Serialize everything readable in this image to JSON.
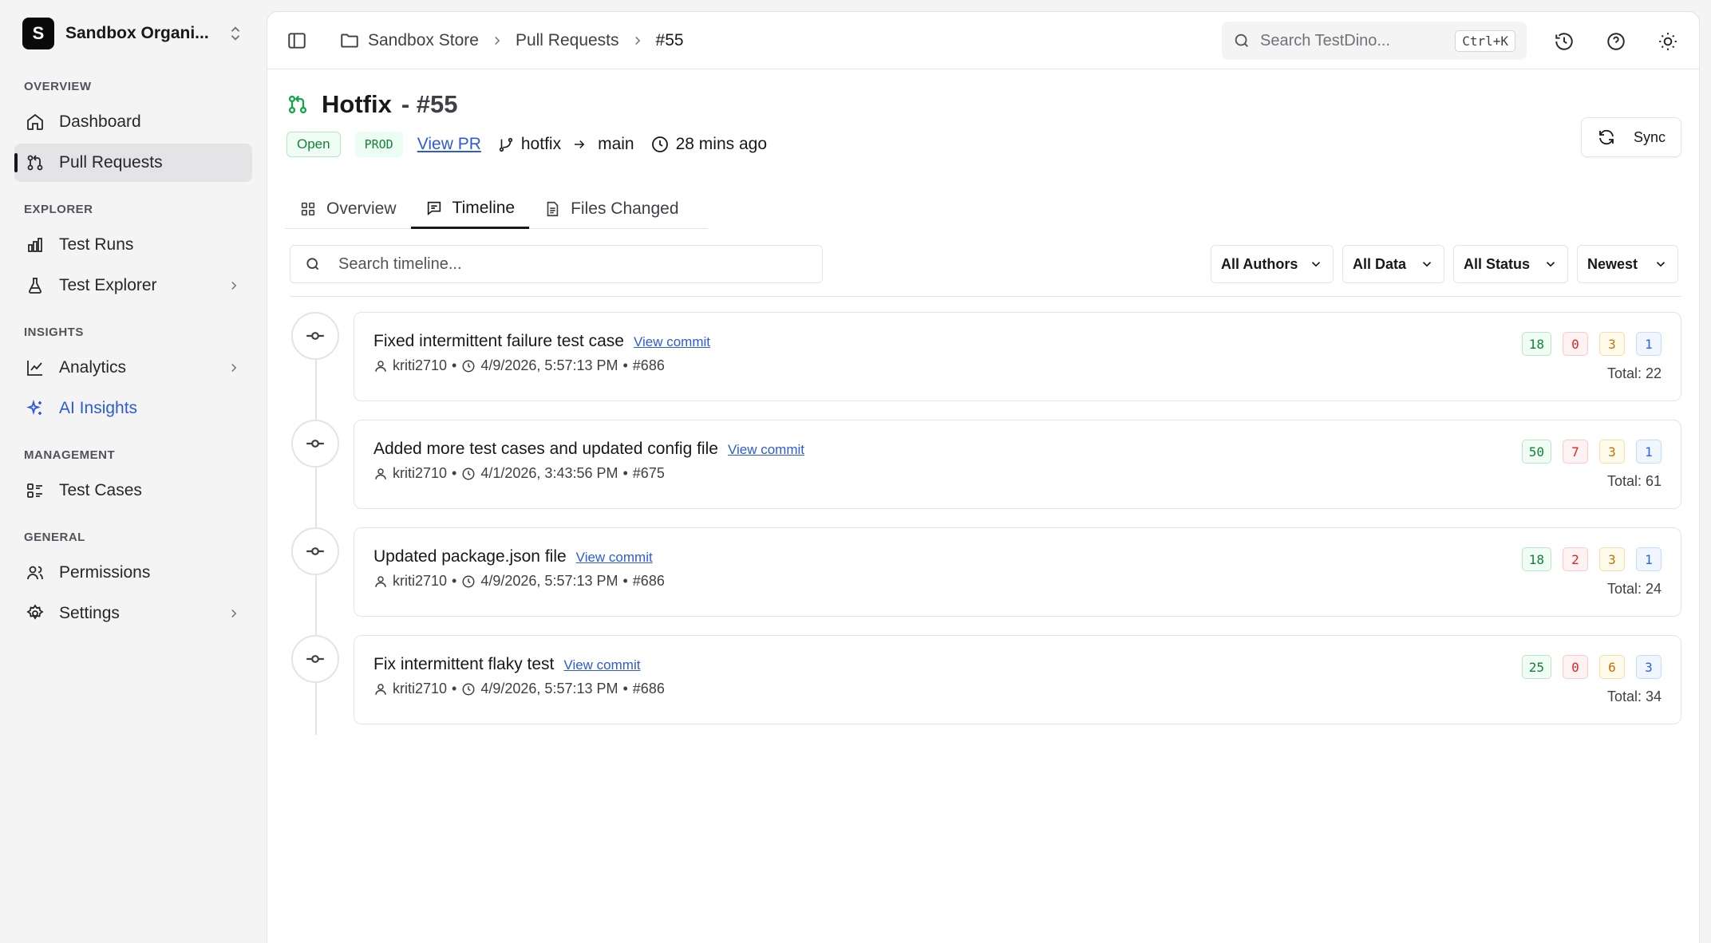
{
  "sidebar": {
    "org_initial": "S",
    "org_name": "Sandbox Organi...",
    "sections": {
      "overview": "OVERVIEW",
      "explorer": "EXPLORER",
      "insights": "INSIGHTS",
      "management": "MANAGEMENT",
      "general": "GENERAL"
    },
    "items": {
      "dashboard": "Dashboard",
      "pull_requests": "Pull Requests",
      "test_runs": "Test Runs",
      "test_explorer": "Test Explorer",
      "analytics": "Analytics",
      "ai_insights": "AI Insights",
      "test_cases": "Test Cases",
      "permissions": "Permissions",
      "settings": "Settings"
    }
  },
  "topbar": {
    "breadcrumb": [
      "Sandbox Store",
      "Pull Requests",
      "#55"
    ],
    "search_placeholder": "Search TestDino...",
    "shortcut": "Ctrl+K"
  },
  "pr": {
    "title": "Hotfix",
    "number": "- #55",
    "status": "Open",
    "env": "PROD",
    "view_pr": "View PR",
    "source_branch": "hotfix",
    "target_branch": "main",
    "updated": "28 mins ago",
    "sync_label": "Sync"
  },
  "tabs": [
    "Overview",
    "Timeline",
    "Files Changed"
  ],
  "timeline": {
    "search_placeholder": "Search timeline...",
    "filters": [
      "All Authors",
      "All Data",
      "All Status",
      "Newest"
    ],
    "view_commit_label": "View commit",
    "commits": [
      {
        "title": "Fixed intermittent failure test case",
        "author": "kriti2710",
        "datetime": "4/9/2026, 5:57:13 PM",
        "run": "#686",
        "passed": "18",
        "failed": "0",
        "flaky": "3",
        "skipped": "1",
        "total": "Total: 22"
      },
      {
        "title": "Added more test cases and updated config file",
        "author": "kriti2710",
        "datetime": "4/1/2026, 3:43:56 PM",
        "run": "#675",
        "passed": "50",
        "failed": "7",
        "flaky": "3",
        "skipped": "1",
        "total": "Total: 61"
      },
      {
        "title": "Updated package.json file",
        "author": "kriti2710",
        "datetime": "4/9/2026, 5:57:13 PM",
        "run": "#686",
        "passed": "18",
        "failed": "2",
        "flaky": "3",
        "skipped": "1",
        "total": "Total: 24"
      },
      {
        "title": "Fix intermittent flaky test",
        "author": "kriti2710",
        "datetime": "4/9/2026, 5:57:13 PM",
        "run": "#686",
        "passed": "25",
        "failed": "0",
        "flaky": "6",
        "skipped": "3",
        "total": "Total: 34"
      }
    ]
  },
  "colors": {
    "accent": "#2d5bd8",
    "passed": "#15803d",
    "failed": "#dc2626",
    "flaky": "#c2700e",
    "skipped": "#2563eb"
  }
}
